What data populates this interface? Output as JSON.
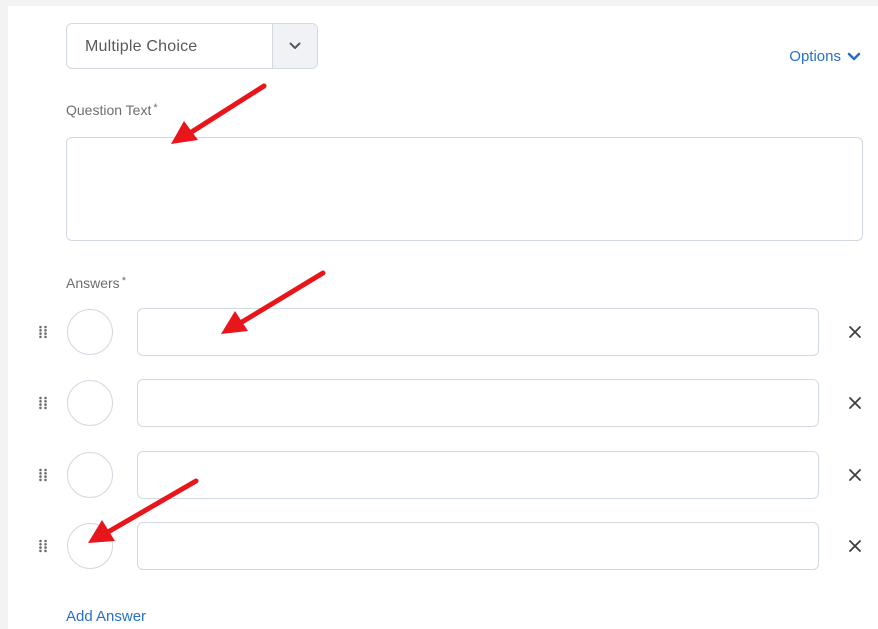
{
  "question_type": {
    "selected": "Multiple Choice"
  },
  "options_link": {
    "label": "Options"
  },
  "question_text": {
    "label": "Question Text",
    "required_marker": "*",
    "value": ""
  },
  "answers": {
    "label": "Answers",
    "required_marker": "*",
    "items": [
      {
        "value": ""
      },
      {
        "value": ""
      },
      {
        "value": ""
      },
      {
        "value": ""
      }
    ],
    "add_label": "Add Answer"
  },
  "colors": {
    "accent": "#2871c4",
    "annotation_arrow": "#e8161b",
    "border": "#d3d9e3"
  },
  "icons": {
    "select_caret": "chevron-down-icon",
    "options_caret": "chevron-down-icon",
    "drag": "drag-handle-icon",
    "remove": "close-icon",
    "annotation": "arrow-icon"
  }
}
